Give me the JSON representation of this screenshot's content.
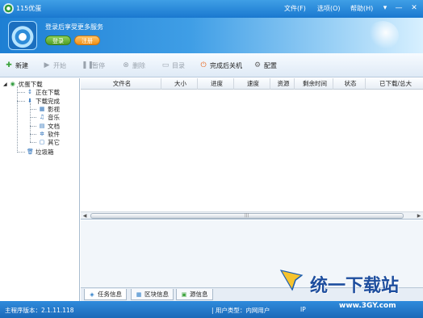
{
  "window": {
    "title": "115优蛋"
  },
  "menu": {
    "file": "文件(F)",
    "options": "选项(O)",
    "help": "帮助(H)"
  },
  "window_controls": {
    "menu": "▾",
    "minimize": "—",
    "close": "✕"
  },
  "banner": {
    "promo_text": "登录后享受更多服务",
    "login_label": "登录",
    "register_label": "注册"
  },
  "toolbar": {
    "new_label": "新建",
    "start_label": "开始",
    "pause_label": "暂停",
    "delete_label": "删除",
    "directory_label": "目录",
    "shutdown_label": "完成后关机",
    "settings_label": "配置"
  },
  "tree": {
    "root": "优蛋下载",
    "downloading": "正在下载",
    "completed": "下载完成",
    "categories": [
      "影视",
      "音乐",
      "文档",
      "软件",
      "其它"
    ],
    "trash": "垃圾箱"
  },
  "list": {
    "columns": [
      "文件名",
      "大小",
      "进度",
      "速度",
      "资源",
      "剩余时间",
      "状态",
      "已下载/总大"
    ],
    "scroll_grip": "|||"
  },
  "tabs": [
    "任务信息",
    "区块信息",
    "源信息"
  ],
  "statusbar": {
    "version": "主程序版本：2.1.11.118",
    "user_type": "| 用户类型：内网用户",
    "ip": "IP"
  },
  "watermark": {
    "text": "统一下载站",
    "url": "www.3GY.com"
  },
  "colors": {
    "titlebar": "#1a78cf",
    "statusbar": "#1b69b8",
    "login": "#4f9e27",
    "register": "#f18f15"
  }
}
